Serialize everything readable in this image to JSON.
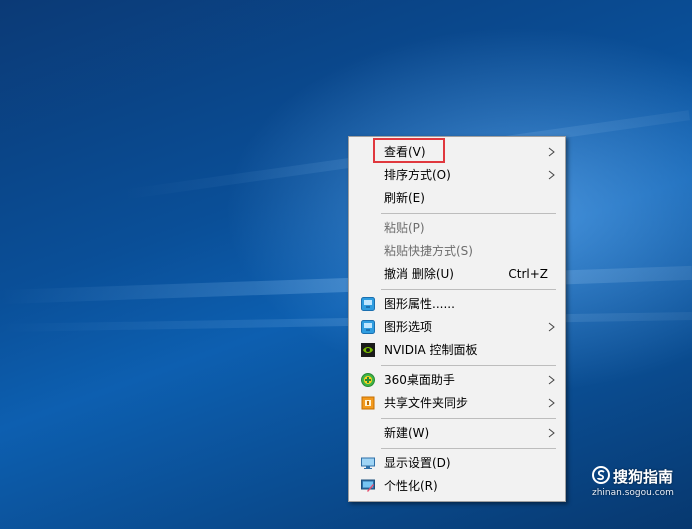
{
  "context_menu": {
    "items": [
      {
        "label": "查看(V)",
        "shortcut": "",
        "submenu": true,
        "disabled": false,
        "icon": ""
      },
      {
        "label": "排序方式(O)",
        "shortcut": "",
        "submenu": true,
        "disabled": false,
        "icon": ""
      },
      {
        "label": "刷新(E)",
        "shortcut": "",
        "submenu": false,
        "disabled": false,
        "icon": ""
      },
      {
        "label": "粘贴(P)",
        "shortcut": "",
        "submenu": false,
        "disabled": true,
        "icon": ""
      },
      {
        "label": "粘贴快捷方式(S)",
        "shortcut": "",
        "submenu": false,
        "disabled": true,
        "icon": ""
      },
      {
        "label": "撤消 删除(U)",
        "shortcut": "Ctrl+Z",
        "submenu": false,
        "disabled": false,
        "icon": ""
      },
      {
        "label": "图形属性......",
        "shortcut": "",
        "submenu": false,
        "disabled": false,
        "icon": "intel-graphics-icon"
      },
      {
        "label": "图形选项",
        "shortcut": "",
        "submenu": true,
        "disabled": false,
        "icon": "intel-graphics-icon"
      },
      {
        "label": "NVIDIA 控制面板",
        "shortcut": "",
        "submenu": false,
        "disabled": false,
        "icon": "nvidia-icon"
      },
      {
        "label": "360桌面助手",
        "shortcut": "",
        "submenu": true,
        "disabled": false,
        "icon": "360-icon"
      },
      {
        "label": "共享文件夹同步",
        "shortcut": "",
        "submenu": true,
        "disabled": false,
        "icon": "folder-sync-icon"
      },
      {
        "label": "新建(W)",
        "shortcut": "",
        "submenu": true,
        "disabled": false,
        "icon": ""
      },
      {
        "label": "显示设置(D)",
        "shortcut": "",
        "submenu": false,
        "disabled": false,
        "icon": "display-settings-icon"
      },
      {
        "label": "个性化(R)",
        "shortcut": "",
        "submenu": false,
        "disabled": false,
        "icon": "personalize-icon"
      }
    ]
  },
  "watermark": {
    "name": "搜狗指南",
    "domain": "zhinan.sogou.com"
  },
  "colors": {
    "highlight_box": "#e0383e",
    "menu_background": "#f2f2f2",
    "desktop_blue": "#0a4f98"
  }
}
